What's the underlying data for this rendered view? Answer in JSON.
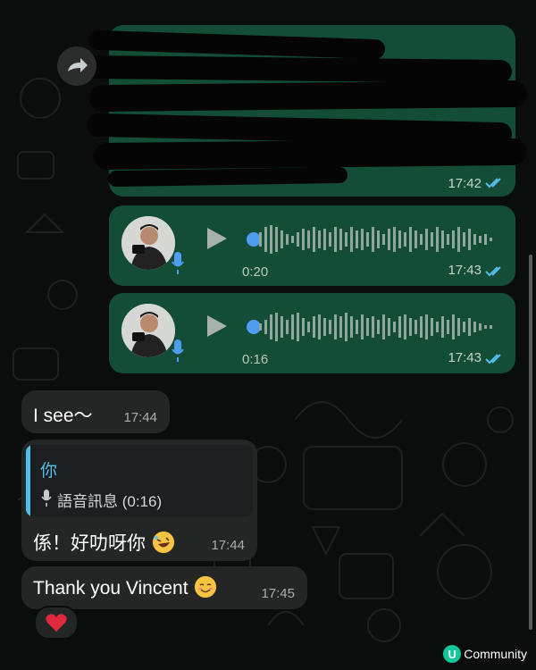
{
  "colors": {
    "outgoing_bubble": "#134d37",
    "incoming_bubble": "#242626",
    "read_ticks": "#53bdeb",
    "accent_quote": "#53bdeb",
    "reaction_heart": "#e0293e"
  },
  "messages": {
    "forwarded": {
      "time": "17:42",
      "icon": "forward-icon",
      "status": "read"
    },
    "voice_1": {
      "duration": "0:20",
      "time": "17:43",
      "status": "read"
    },
    "voice_2": {
      "duration": "0:16",
      "time": "17:43",
      "status": "read"
    },
    "msg_1": {
      "text": "I see～",
      "time": "17:44"
    },
    "reply": {
      "quote_author": "你",
      "quote_text": "語音訊息 (0:16)",
      "text": "係！好叻呀你",
      "emoji": "rolling-on-floor-laughing-emoji",
      "time": "17:44"
    },
    "msg_3": {
      "text": "Thank you Vincent",
      "emoji": "smiling-face-emoji",
      "time": "17:45",
      "reaction": "red-heart-emoji"
    }
  },
  "watermark": {
    "logo_letter": "U",
    "text": "Community"
  }
}
